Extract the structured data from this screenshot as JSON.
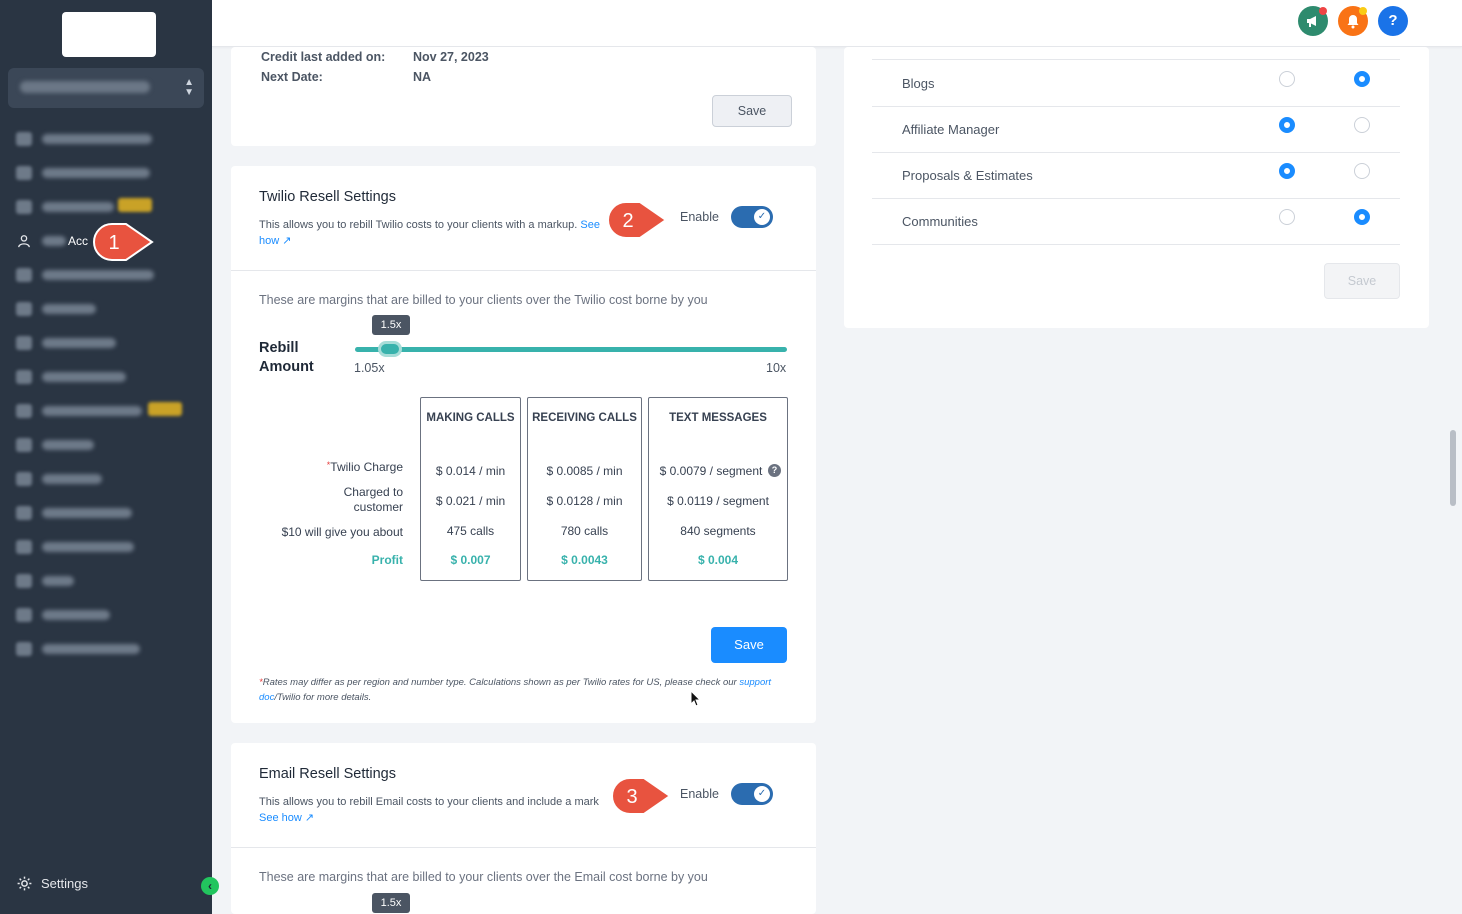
{
  "sidebar": {
    "active_label": "Acc",
    "settings_label": "Settings",
    "nav_items": [
      {
        "name": "nav-agency-dashboard"
      },
      {
        "name": "nav-saas-configurator"
      },
      {
        "name": "nav-prospecting"
      },
      {
        "name": "nav-sub-accounts"
      },
      {
        "name": "nav-account-snapshots"
      },
      {
        "name": "nav-reselling"
      },
      {
        "name": "nav-marketplace"
      },
      {
        "name": "nav-affiliate-portal"
      },
      {
        "name": "nav-template-library"
      },
      {
        "name": "nav-partners"
      },
      {
        "name": "nav-university"
      },
      {
        "name": "nav-saas-education"
      },
      {
        "name": "nav-saas-fasttrack"
      },
      {
        "name": "nav-ideas"
      },
      {
        "name": "nav-mobile-app"
      },
      {
        "name": "nav-app-marketplace"
      }
    ]
  },
  "topbar": {
    "help_label": "?",
    "colors": {
      "announce": "#2e8b6e",
      "bell": "#f97316",
      "help": "#1a73e8"
    }
  },
  "credit": {
    "last_added_label": "Credit last added on:",
    "last_added_value": "Nov 27, 2023",
    "next_date_label": "Next Date:",
    "next_date_value": "NA",
    "save_label": "Save"
  },
  "twilio": {
    "title": "Twilio Resell Settings",
    "desc": "This allows you to rebill Twilio costs to your clients with a markup.",
    "see_how_prefix": "See",
    "see_how_suffix": "how",
    "enable_label": "Enable",
    "margin_text": "These are margins that are billed to your clients over the Twilio cost borne by you",
    "rebill_label_1": "Rebill",
    "rebill_label_2": "Amount",
    "slider_value": "1.5x",
    "slider_min": "1.05x",
    "slider_max": "10x",
    "row_labels": {
      "charge": "Twilio Charge",
      "charge_mark": "*",
      "charged_1": "Charged to",
      "charged_2": "customer",
      "ten": "$10 will give you about",
      "profit": "Profit"
    },
    "columns": [
      {
        "header": "MAKING CALLS",
        "charge": "$ 0.014 / min",
        "charged": "$ 0.021 / min",
        "about": "475 calls",
        "profit": "$ 0.007"
      },
      {
        "header": "RECEIVING CALLS",
        "charge": "$ 0.0085 / min",
        "charged": "$ 0.0128 / min",
        "about": "780 calls",
        "profit": "$ 0.0043"
      },
      {
        "header": "TEXT MESSAGES",
        "charge": "$ 0.0079 / segment",
        "charged": "$ 0.0119 / segment",
        "about": "840 segments",
        "profit": "$ 0.004"
      }
    ],
    "save_label": "Save",
    "footnote_mark": "*",
    "footnote_1": "Rates may differ as per region and number type. Calculations shown as per Twilio rates for US, please check our",
    "footnote_link": "support doc",
    "footnote_2": "/Twilio for more details."
  },
  "email": {
    "title": "Email Resell Settings",
    "desc": "This allows you to rebill Email costs to your clients and include a mark",
    "see_how": "See how",
    "enable_label": "Enable",
    "margin_text": "These are margins that are billed to your clients over the Email cost borne by you",
    "slider_value": "1.5x"
  },
  "markers": [
    "1",
    "2",
    "3"
  ],
  "features": {
    "rows": [
      {
        "label": "Blogs",
        "first_on": false
      },
      {
        "label": "Affiliate Manager",
        "first_on": true
      },
      {
        "label": "Proposals & Estimates",
        "first_on": true
      },
      {
        "label": "Communities",
        "first_on": false
      }
    ],
    "save_label": "Save"
  }
}
